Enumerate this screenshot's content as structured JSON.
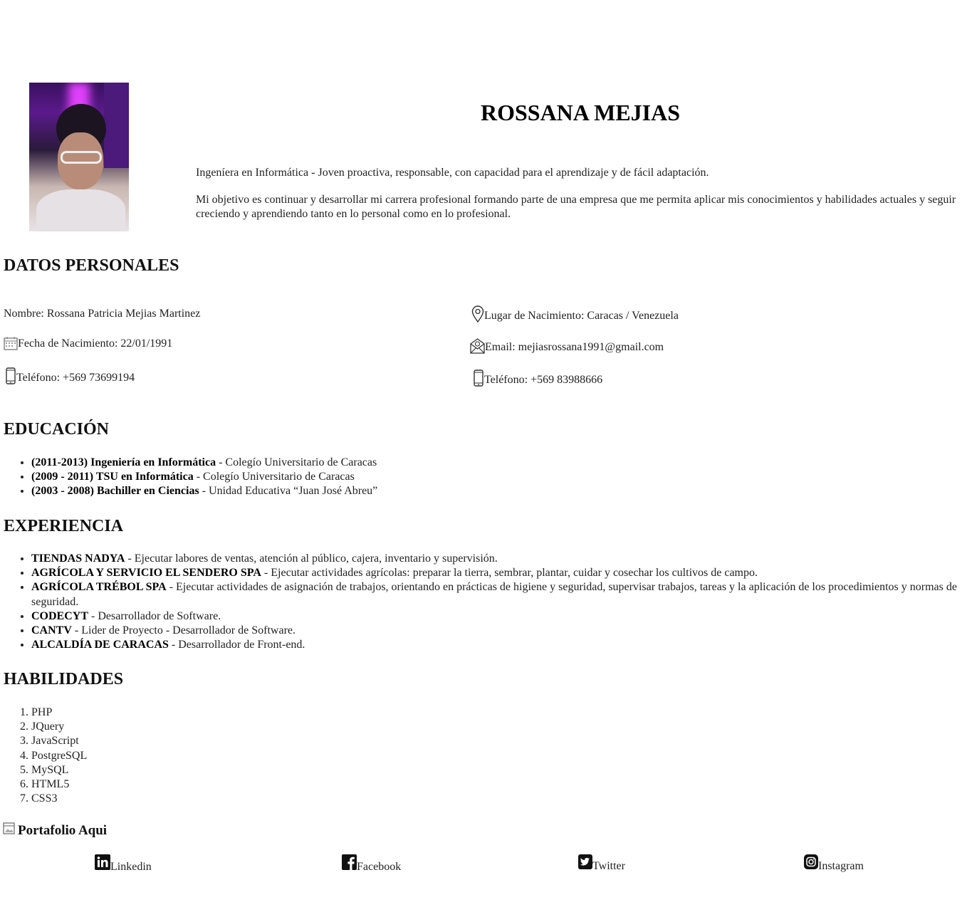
{
  "header": {
    "name": "ROSSANA MEJIAS",
    "intro": "Ingeníera en Informática - Joven proactiva, responsable, con capacidad para el aprendizaje y de fácil adaptación.",
    "objective": "Mi objetivo es continuar y desarrollar mi carrera profesional formando parte de una empresa que me permita aplicar mis conocimientos y habilidades actuales y seguir creciendo y aprendiendo tanto en lo personal como en lo profesional."
  },
  "personal": {
    "title": "DATOS PERSONALES",
    "nombre": "Nombre: Rossana Patricia Mejias Martinez",
    "fecha": "Fecha de Nacimiento: 22/01/1991",
    "telefono1": "Teléfono: +569 73699194",
    "lugar": "Lugar de Nacimiento: Caracas / Venezuela",
    "email": "Email: mejiasrossana1991@gmail.com",
    "telefono2": "Teléfono: +569 83988666"
  },
  "education": {
    "title": "EDUCACIÓN",
    "items": [
      {
        "bold": "(2011-2013) Ingeniería en Informática",
        "rest": " - Colegío Universitario de Caracas"
      },
      {
        "bold": "(2009 - 2011) TSU en Informática",
        "rest": " - Colegío Universitario de Caracas"
      },
      {
        "bold": "(2003 - 2008) Bachiller en Ciencias",
        "rest": " - Unidad Educativa “Juan José Abreu”"
      }
    ]
  },
  "experience": {
    "title": "EXPERIENCIA",
    "items": [
      {
        "bold": "TIENDAS NADYA",
        "rest": " - Ejecutar labores de ventas, atención al público, cajera, inventario y supervisión."
      },
      {
        "bold": "AGRÍCOLA Y SERVICIO EL SENDERO SPA",
        "rest": " - Ejecutar actividades agrícolas: preparar la tierra, sembrar, plantar, cuidar y cosechar los cultivos de campo."
      },
      {
        "bold": "AGRÍCOLA TRÉBOL SPA",
        "rest": " - Ejecutar actividades de asignación de trabajos, orientando en prácticas de higiene y seguridad, supervisar trabajos, tareas y la aplicación de los procedimientos y normas de seguridad."
      },
      {
        "bold": "CODECYT",
        "rest": " - Desarrollador de Software."
      },
      {
        "bold": "CANTV",
        "rest": " - Lider de Proyecto - Desarrollador de Software."
      },
      {
        "bold": "ALCALDÍA DE CARACAS",
        "rest": " - Desarrollador de Front-end."
      }
    ]
  },
  "skills": {
    "title": "HABILIDADES",
    "items": [
      "PHP",
      "JQuery",
      "JavaScript",
      "PostgreSQL",
      "MySQL",
      "HTML5",
      "CSS3"
    ]
  },
  "portfolio": {
    "label": "Portafolio Aqui",
    "icon": "image-icon"
  },
  "social": {
    "linkedin": "Linkedin",
    "facebook": "Facebook",
    "twitter": "Twitter",
    "instagram": "Instagram"
  }
}
